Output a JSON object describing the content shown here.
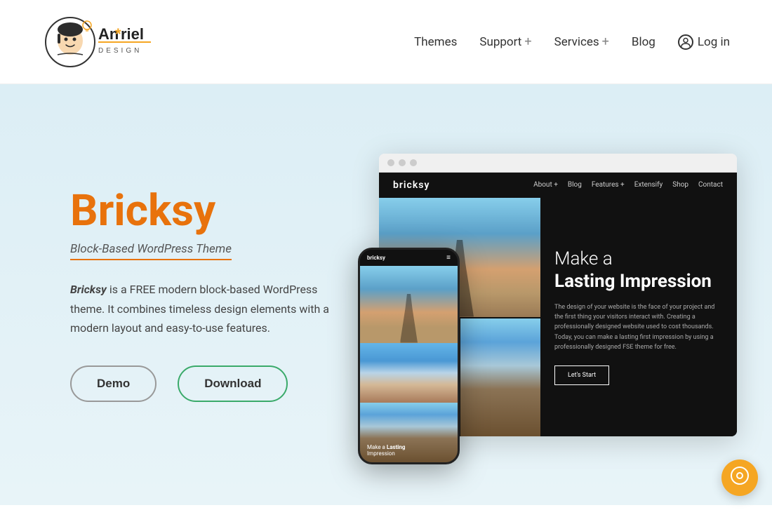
{
  "header": {
    "logo": {
      "name": "Anariel",
      "asterisk": "*",
      "design_label": "DESIGN"
    },
    "nav": {
      "items": [
        {
          "label": "Themes",
          "has_plus": false
        },
        {
          "label": "Support",
          "has_plus": true
        },
        {
          "label": "Services",
          "has_plus": true
        },
        {
          "label": "Blog",
          "has_plus": false
        }
      ],
      "login_label": "Log in"
    }
  },
  "hero": {
    "title": "Bricksy",
    "subtitle": "Block-Based WordPress Theme",
    "description_part1": "Bricksy",
    "description_rest": " is a FREE modern block-based WordPress theme. It combines timeless design elements with a modern layout and easy-to-use features.",
    "btn_demo": "Demo",
    "btn_download": "Download"
  },
  "demo_browser": {
    "nav_logo": "bricksy",
    "nav_links": [
      "About +",
      "Blog",
      "Features +",
      "Extensify",
      "Shop",
      "Contact"
    ],
    "headline_pre": "Make a ",
    "headline_bold": "Lasting Impression",
    "body_text": "The design of your website is the face of your project and the first thing your visitors interact with. Creating a professionally designed website used to cost thousands. Today, you can make a lasting first impression by using a professionally designed FSE theme for free.",
    "cta_label": "Let's Start"
  },
  "mobile_demo": {
    "logo": "bricksy",
    "caption_pre": "Make a ",
    "caption_bold": "Lasting",
    "caption_line2": "Impression"
  },
  "chat": {
    "icon": "💬"
  }
}
